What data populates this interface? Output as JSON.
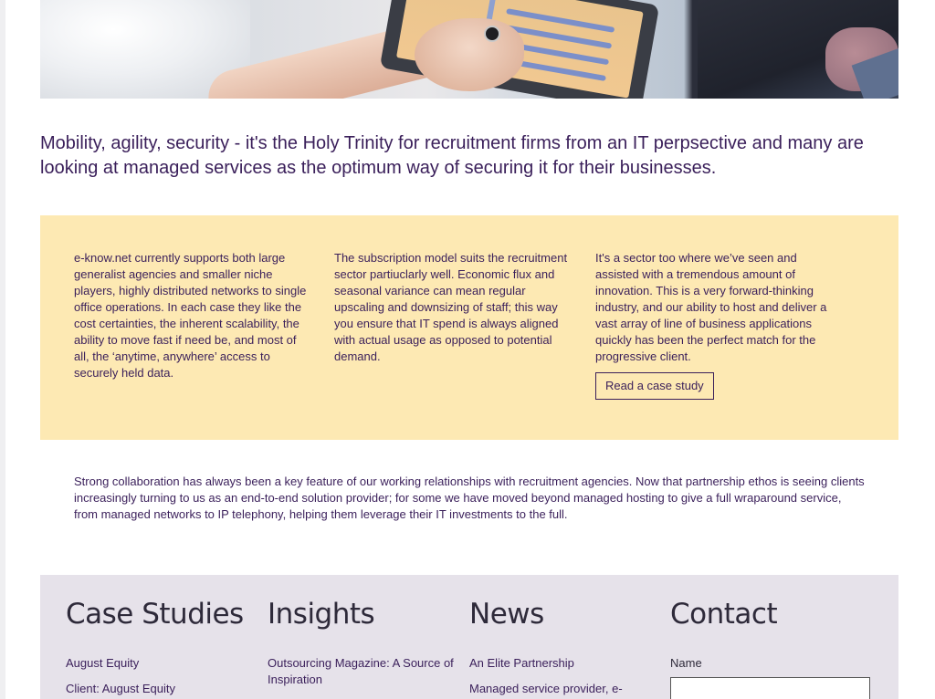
{
  "intro": {
    "text": "Mobility, agility, security - it's the Holy Trinity for recruitment firms from an IT perpsective and many are looking at managed services as the optimum way of securing it for their businesses."
  },
  "columns": [
    {
      "text": "e-know.net currently supports both large generalist agencies and smaller niche players, highly distributed networks to single office operations. In each case they like the cost certainties, the inherent scalability, the ability to move fast if need be, and most of all, the ‘anytime, anywhere’ access to securely held data."
    },
    {
      "text": "The subscription model suits the recruitment sector partiuclarly well. Economic flux and seasonal variance can mean regular upscaling and downsizing of staff; this way you ensure that IT spend is always aligned with actual usage as opposed to potential demand."
    },
    {
      "text": "It's a sector too where we’ve seen and assisted with a tremendous amount of innovation. This is a very forward-thinking industry, and our ability to host and deliver a vast array of line of business applications quickly has been the perfect match for the progressive client."
    }
  ],
  "case_study_button": "Read a case study",
  "collaboration": {
    "text": "Strong collaboration has always been a key feature of our working relationships with recruitment agencies. Now that partnership ethos is seeing clients increasingly turning to us as an end-to-end solution provider; for some we have moved beyond managed hosting to give a full wraparound service, from managed networks to IP telephony, helping them leverage their IT investments to the full."
  },
  "footer": {
    "case_studies": {
      "heading": "Case Studies",
      "links": [
        "August Equity",
        "Client: August Equity"
      ]
    },
    "insights": {
      "heading": "Insights",
      "links": [
        "Outsourcing Magazine: A Source of Inspiration"
      ]
    },
    "news": {
      "heading": "News",
      "links": [
        "An Elite Partnership",
        "Managed service provider, e-"
      ]
    },
    "contact": {
      "heading": "Contact",
      "name_label": "Name",
      "name_value": ""
    }
  },
  "colors": {
    "text_purple": "#3a1f5a",
    "yellow_band": "#fde9b3",
    "footer_bg": "#e6e2ea"
  }
}
